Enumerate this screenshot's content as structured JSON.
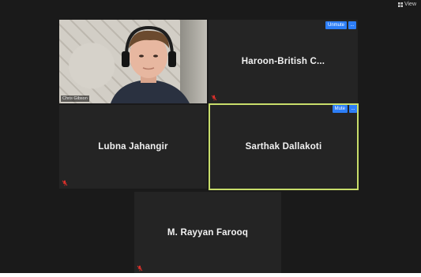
{
  "app": {
    "view_label": "View"
  },
  "participants": [
    {
      "name": "Chris Gibson",
      "video": true,
      "muted": false
    },
    {
      "name": "Haroon-British  C...",
      "muted": true,
      "controls": {
        "unmute_label": "Unmute",
        "more_label": "..."
      }
    },
    {
      "name": "Lubna Jahangir",
      "muted": true
    },
    {
      "name": "Sarthak Dallakoti",
      "active_speaker": true,
      "controls": {
        "mute_label": "Mute",
        "more_label": "..."
      }
    },
    {
      "name": "M. Rayyan Farooq",
      "muted": true
    }
  ],
  "colors": {
    "background": "#1a1a1a",
    "tile": "#242424",
    "active_speaker_border": "#c8dd6a",
    "control_button": "#2d7ef7",
    "muted_mic": "#e0312b"
  },
  "icons": [
    "grid-view-icon",
    "muted-mic-icon",
    "more-options-icon"
  ]
}
